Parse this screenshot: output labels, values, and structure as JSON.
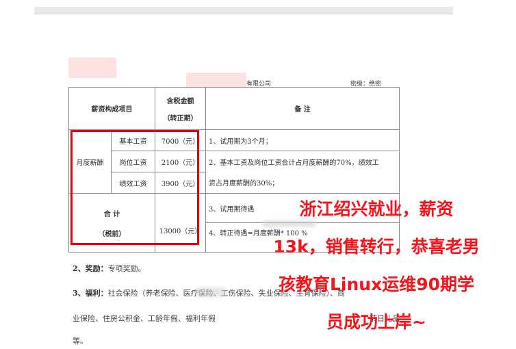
{
  "header": {
    "company_suffix": "有限公司",
    "secrecy": "密级：绝密"
  },
  "table": {
    "col_item": "薪资构成项目",
    "col_amount_l1": "含税金额",
    "col_amount_l2": "（转正期）",
    "col_notes": "备 注",
    "group_label": "月度薪酬",
    "rows": [
      {
        "item": "基本工资",
        "amount": "7000（元）"
      },
      {
        "item": "岗位工资",
        "amount": "2100（元）"
      },
      {
        "item": "绩效工资",
        "amount": "3900（元）"
      }
    ],
    "total_l1": "合 计",
    "total_l2": "（税前）",
    "total_amount": "13000（元）",
    "notes": [
      "1、试用期为3个月；",
      "2、基本工资及岗位工资合计占月度薪酬的70%，绩效工",
      "资占月度薪酬的30%；",
      "3、试用期待遇",
      "4、转正待遇=月度薪酬* 100 %"
    ]
  },
  "body": {
    "bonus_label": "2、奖励：",
    "bonus_text": "专项奖励。",
    "welfare_label": "3、福利：",
    "welfare_text": "社会保险（养老保险、医疗保险、工伤保险、失业保险、生育保险）、商",
    "welfare_cont": "业保险、住房公积金、工龄年假、福利年假",
    "welfare_tail": "节日礼品",
    "welfare_end": "等。"
  },
  "overlay_lines": [
    "浙江绍兴就业，薪资",
    "13k，销售转行，恭喜老男",
    "孩教育Linux运维90期学",
    "员成功上岸~"
  ],
  "colors": {
    "highlight_red": "#e8000b",
    "overlay_red": "#f5141c",
    "redaction_pink": "#fde2e2"
  }
}
